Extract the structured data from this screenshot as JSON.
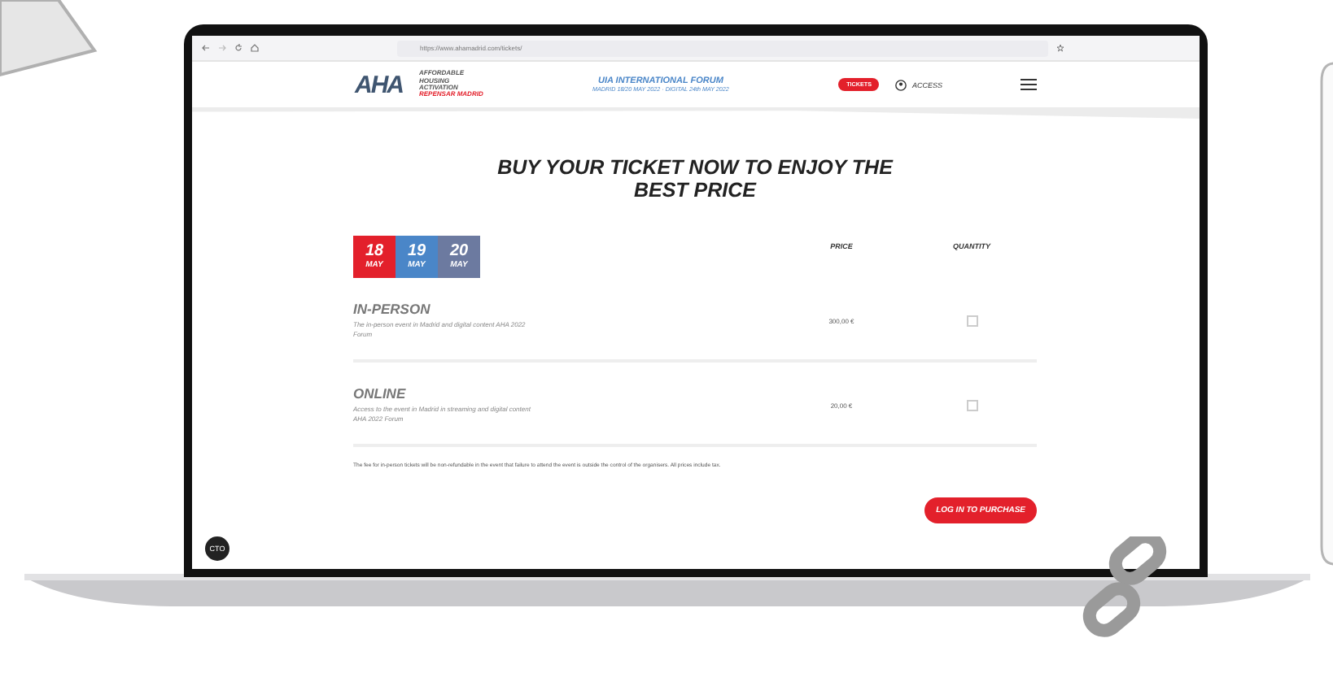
{
  "browser": {
    "url": "https://www.ahamadrid.com/tickets/"
  },
  "header": {
    "logo": "AHA",
    "logo_lines": [
      "AFFORDABLE",
      "HOUSING",
      "ACTIVATION"
    ],
    "logo_tag": "REPENSAR MADRID",
    "event_title": "UIA INTERNATIONAL FORUM",
    "event_dates": "MADRID 18/20 MAY 2022 · DIGITAL 24th MAY 2022",
    "tickets_button": "TICKETS",
    "access_link": "ACCESS"
  },
  "title": "BUY YOUR TICKET NOW TO ENJOY THE BEST PRICE",
  "dates": [
    {
      "day": "18",
      "month": "MAY",
      "color": "#e3202b"
    },
    {
      "day": "19",
      "month": "MAY",
      "color": "#4a86c8"
    },
    {
      "day": "20",
      "month": "MAY",
      "color": "#6c7aa0"
    }
  ],
  "columns": [
    "PRICE",
    "QUANTITY"
  ],
  "tickets": [
    {
      "name": "IN-PERSON",
      "description": "The in-person event in Madrid and digital content AHA 2022 Forum",
      "price": "300,00 €"
    },
    {
      "name": "ONLINE",
      "description": "Access to the event in Madrid in streaming and digital content AHA 2022 Forum",
      "price": "20,00 €"
    }
  ],
  "note": "The fee for in-person tickets will be non-refundable in the event that failure to attend the event is outside the control of the organisers. All prices include tax.",
  "purchase_button": "LOG IN TO PURCHASE",
  "cookie_badge": "CTO"
}
